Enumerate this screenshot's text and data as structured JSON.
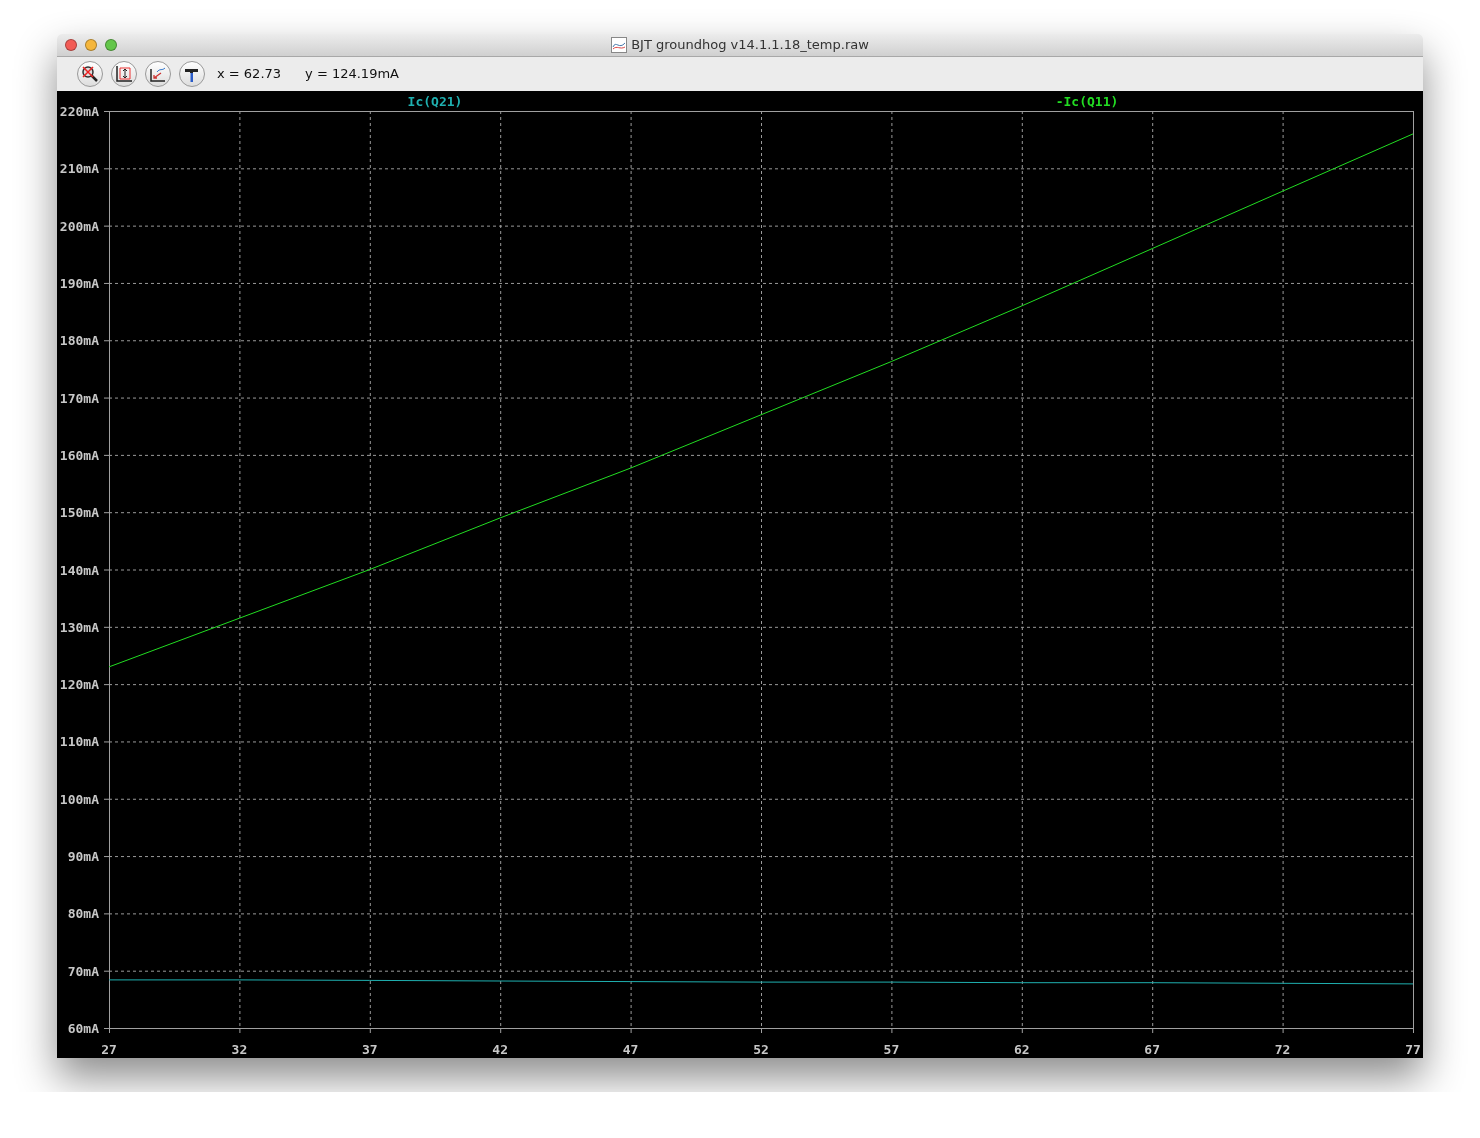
{
  "window": {
    "title": "BJT groundhog v14.1.1.18_temp.raw"
  },
  "cursor_readout": {
    "x": "x = 62.73",
    "y": "y = 124.19mA"
  },
  "plot": {
    "chart_data": {
      "type": "line",
      "x": [
        27,
        32,
        37,
        42,
        47,
        52,
        57,
        62,
        67,
        72,
        77
      ],
      "series": [
        {
          "name": "Ic(Q21)",
          "color": "#1fb0b0",
          "values": [
            68.4,
            68.4,
            68.3,
            68.2,
            68.1,
            68.0,
            68.0,
            67.9,
            67.9,
            67.8,
            67.7
          ]
        },
        {
          "name": "-Ic(Q11)",
          "color": "#22dd22",
          "values": [
            123,
            131.5,
            140,
            149,
            157.7,
            167,
            176.3,
            186,
            196,
            206,
            216
          ]
        }
      ],
      "grid": true,
      "xlim": [
        27,
        77
      ],
      "ylim": [
        60,
        220
      ],
      "xticks": [
        27,
        32,
        37,
        42,
        47,
        52,
        57,
        62,
        67,
        72,
        77
      ],
      "yticks": [
        {
          "value": 60,
          "label": "60mA"
        },
        {
          "value": 70,
          "label": "70mA"
        },
        {
          "value": 80,
          "label": "80mA"
        },
        {
          "value": 90,
          "label": "90mA"
        },
        {
          "value": 100,
          "label": "100mA"
        },
        {
          "value": 110,
          "label": "110mA"
        },
        {
          "value": 120,
          "label": "120mA"
        },
        {
          "value": 130,
          "label": "130mA"
        },
        {
          "value": 140,
          "label": "140mA"
        },
        {
          "value": 150,
          "label": "150mA"
        },
        {
          "value": 160,
          "label": "160mA"
        },
        {
          "value": 170,
          "label": "170mA"
        },
        {
          "value": 180,
          "label": "180mA"
        },
        {
          "value": 190,
          "label": "190mA"
        },
        {
          "value": 200,
          "label": "200mA"
        },
        {
          "value": 210,
          "label": "210mA"
        },
        {
          "value": 220,
          "label": "220mA"
        }
      ]
    }
  }
}
